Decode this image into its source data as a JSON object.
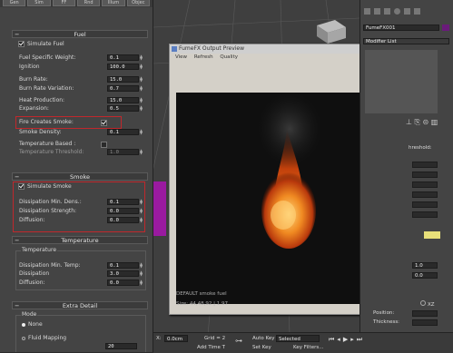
{
  "top_tabs": [
    "Gen",
    "Sim",
    "FF",
    "Rnd",
    "Illum",
    "Objec"
  ],
  "fuel": {
    "header": "Fuel",
    "simulate_label": "Simulate Fuel",
    "rows": [
      {
        "label": "Fuel Specific Weight:",
        "value": "0.1"
      },
      {
        "label": "Ignition",
        "value": "100.0"
      },
      {
        "label": "Burn Rate:",
        "value": "15.0"
      },
      {
        "label": "Burn Rate Variation:",
        "value": "0.7"
      },
      {
        "label": "Heat Production:",
        "value": "15.0"
      },
      {
        "label": "Expansion:",
        "value": "0.5"
      }
    ],
    "fire_creates_smoke": "Fire Creates Smoke:",
    "smoke_density_label": "Smoke Density:",
    "smoke_density_value": "0.1",
    "temperature_based": "Temperature Based :",
    "temperature_threshold": "Temperature Threshold:",
    "temperature_threshold_value": "1.0"
  },
  "smoke": {
    "header": "Smoke",
    "simulate_label": "Simulate Smoke",
    "rows": [
      {
        "label": "Dissipation Min. Dens.:",
        "value": "0.1"
      },
      {
        "label": "Dissipation Strength:",
        "value": "0.0"
      },
      {
        "label": "Diffusion:",
        "value": "0.0"
      }
    ]
  },
  "temperature": {
    "header": "Temperature",
    "sub": "Temperature",
    "rows": [
      {
        "label": "Dissipation Min. Temp:",
        "value": "0.1"
      },
      {
        "label": "Dissipation",
        "value": "3.0"
      },
      {
        "label": "Diffusion:",
        "value": "0.0"
      }
    ]
  },
  "extra_detail": {
    "header": "Extra Detail",
    "mode_label": "Mode",
    "options": [
      "None",
      "Fluid Mapping"
    ],
    "iterations_value": "20"
  },
  "preview": {
    "title": "FumeFX Output Preview",
    "menu": [
      "View",
      "Refresh",
      "Quality"
    ],
    "status_line": "DEFAULT smoke fuel",
    "size_line": "Size: 44,48,92 | 1.97"
  },
  "right_panel": {
    "name_value": "FumeFX001",
    "modifier_list": "Modifier List",
    "threshold": "hreshold:",
    "value_1": "1.0",
    "value_2": "0.0",
    "position_label": "Position:",
    "thickness_label": "Thickness:",
    "xz_label": "XZ",
    "brand_color": "#e8e07a"
  },
  "bottom_bar": {
    "x_value": "0.0cm",
    "grid": "Grid = 2",
    "add_time": "Add Time T",
    "auto_key": "Auto Key",
    "selected": "Selected",
    "set_key": "Set Key",
    "key_filters": "Key Filters..."
  }
}
